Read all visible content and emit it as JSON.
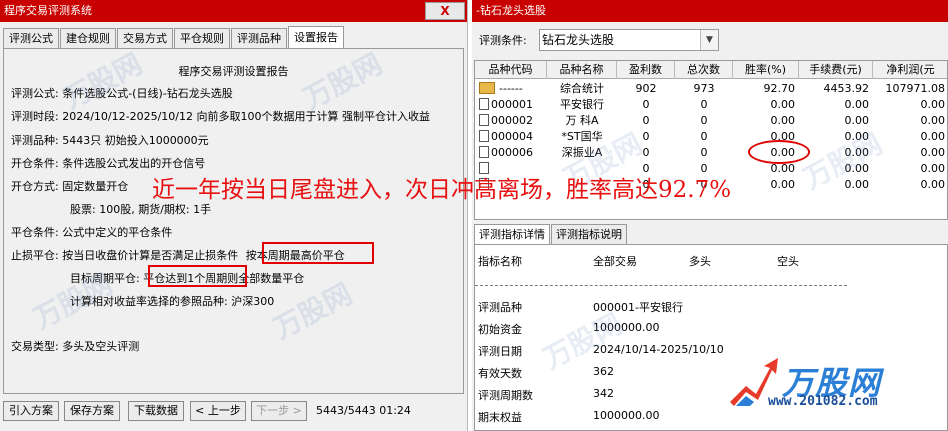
{
  "left": {
    "title": "程序交易评测系统",
    "close": "X",
    "tabs": [
      "评测公式",
      "建仓规则",
      "交易方式",
      "平仓规则",
      "评测品种",
      "设置报告"
    ],
    "report_title": "程序交易评测设置报告",
    "rows": {
      "r1": "评测公式:  条件选股公式-(日线)-钻石龙头选股",
      "r2": "评测时段:  2024/10/12-2025/10/12 向前多取100个数据用于计算 强制平仓计入收益",
      "r3": "评测品种:  5443只 初始投入1000000元",
      "r4": "开仓条件:  条件选股公式发出的开仓信号",
      "r5": "开仓方式:  固定数量开仓",
      "r6": "股票: 100股, 期货/期权: 1手",
      "r7": "平仓条件:  公式中定义的平仓条件",
      "r8a": "止损平仓:  按当日收盘价计算是否满足止损条件",
      "r8b": "按本周期最高价平仓",
      "r9a": "目标周期平仓: ",
      "r9b": "平仓达到1个周期",
      "r9c": "则全部数量平仓",
      "r10": "计算相对收益率选择的参照品种:  沪深300",
      "r11": "交易类型:  多头及空头评测"
    },
    "buttons": {
      "import": "引入方案",
      "save": "保存方案",
      "download": "下载数据",
      "prev": "< 上一步",
      "next": "下一步 >"
    },
    "status": "5443/5443 01:24"
  },
  "right": {
    "title": "-钻石龙头选股",
    "cond_label": "评测条件:",
    "cond_value": "钻石龙头选股",
    "grid": {
      "headers": [
        "品种代码",
        "品种名称",
        "盈利数",
        "总次数",
        "胜率(%)",
        "手续费(元)",
        "净利润(元"
      ],
      "rows": [
        {
          "code": "------",
          "name": "综合统计",
          "win": "902",
          "total": "973",
          "rate": "92.70",
          "fee": "4453.92",
          "profit": "107971.08"
        },
        {
          "code": "000001",
          "name": "平安银行",
          "win": "0",
          "total": "0",
          "rate": "0.00",
          "fee": "0.00",
          "profit": "0.00"
        },
        {
          "code": "000002",
          "name": "万 科A",
          "win": "0",
          "total": "0",
          "rate": "0.00",
          "fee": "0.00",
          "profit": "0.00"
        },
        {
          "code": "000004",
          "name": "*ST国华",
          "win": "0",
          "total": "0",
          "rate": "0.00",
          "fee": "0.00",
          "profit": "0.00"
        },
        {
          "code": "000006",
          "name": "深振业A",
          "win": "0",
          "total": "0",
          "rate": "0.00",
          "fee": "0.00",
          "profit": "0.00"
        },
        {
          "code": "",
          "name": "",
          "win": "0",
          "total": "0",
          "rate": "0.00",
          "fee": "0.00",
          "profit": "0.00"
        },
        {
          "code": "",
          "name": "",
          "win": "0",
          "total": "0",
          "rate": "0.00",
          "fee": "0.00",
          "profit": "0.00"
        }
      ]
    },
    "tabs": [
      "评测指标详情",
      "评测指标说明"
    ],
    "detail_headers": [
      "指标名称",
      "全部交易",
      "多头",
      "空头"
    ],
    "detail_rows": [
      {
        "label": "评测品种",
        "value": "000001-平安银行"
      },
      {
        "label": "初始资金",
        "value": "1000000.00"
      },
      {
        "label": "评测日期",
        "value": "2024/10/14-2025/10/10"
      },
      {
        "label": "有效天数",
        "value": "362"
      },
      {
        "label": "评测周期数",
        "value": "342"
      },
      {
        "label": "期末权益",
        "value": "1000000.00"
      }
    ]
  },
  "caption": "近一年按当日尾盘进入，次日冲高离场，胜率高达92.7%",
  "watermark": "万股网",
  "logo": {
    "name": "万股网",
    "url": "www.201082.com"
  }
}
